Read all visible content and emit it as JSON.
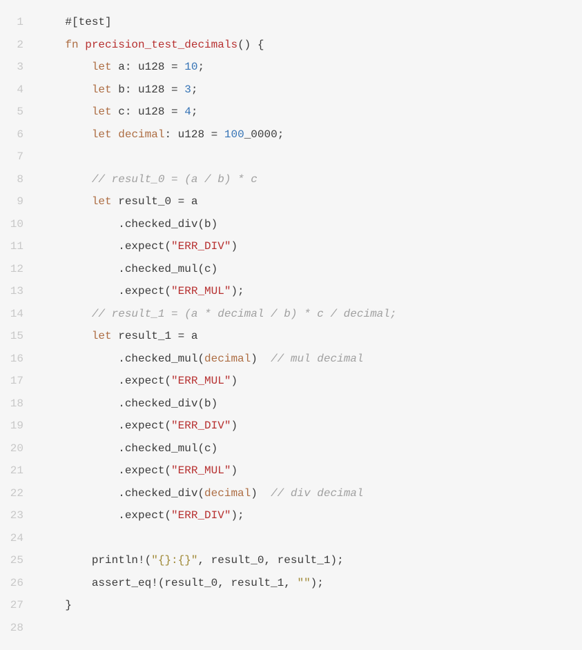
{
  "code": {
    "lines": [
      {
        "n": "1",
        "tokens": [
          {
            "t": "    ",
            "c": "tok-default"
          },
          {
            "t": "#[test]",
            "c": "tok-attr"
          }
        ]
      },
      {
        "n": "2",
        "tokens": [
          {
            "t": "    ",
            "c": "tok-default"
          },
          {
            "t": "fn",
            "c": "tok-keyword"
          },
          {
            "t": " ",
            "c": "tok-default"
          },
          {
            "t": "precision_test_decimals",
            "c": "tok-fn-name"
          },
          {
            "t": "() {",
            "c": "tok-default"
          }
        ]
      },
      {
        "n": "3",
        "tokens": [
          {
            "t": "        ",
            "c": "tok-default"
          },
          {
            "t": "let",
            "c": "tok-keyword"
          },
          {
            "t": " a: u128 = ",
            "c": "tok-default"
          },
          {
            "t": "10",
            "c": "tok-num"
          },
          {
            "t": ";",
            "c": "tok-default"
          }
        ]
      },
      {
        "n": "4",
        "tokens": [
          {
            "t": "        ",
            "c": "tok-default"
          },
          {
            "t": "let",
            "c": "tok-keyword"
          },
          {
            "t": " b: u128 = ",
            "c": "tok-default"
          },
          {
            "t": "3",
            "c": "tok-num"
          },
          {
            "t": ";",
            "c": "tok-default"
          }
        ]
      },
      {
        "n": "5",
        "tokens": [
          {
            "t": "        ",
            "c": "tok-default"
          },
          {
            "t": "let",
            "c": "tok-keyword"
          },
          {
            "t": " c: u128 = ",
            "c": "tok-default"
          },
          {
            "t": "4",
            "c": "tok-num"
          },
          {
            "t": ";",
            "c": "tok-default"
          }
        ]
      },
      {
        "n": "6",
        "tokens": [
          {
            "t": "        ",
            "c": "tok-default"
          },
          {
            "t": "let",
            "c": "tok-keyword"
          },
          {
            "t": " ",
            "c": "tok-default"
          },
          {
            "t": "decimal",
            "c": "tok-ident-deco"
          },
          {
            "t": ": u128 = ",
            "c": "tok-default"
          },
          {
            "t": "100",
            "c": "tok-num"
          },
          {
            "t": "_0000;",
            "c": "tok-default"
          }
        ]
      },
      {
        "n": "7",
        "tokens": [
          {
            "t": "",
            "c": "tok-default"
          }
        ]
      },
      {
        "n": "8",
        "tokens": [
          {
            "t": "        ",
            "c": "tok-default"
          },
          {
            "t": "// result_0 = (a / b) * c",
            "c": "tok-comment"
          }
        ]
      },
      {
        "n": "9",
        "tokens": [
          {
            "t": "        ",
            "c": "tok-default"
          },
          {
            "t": "let",
            "c": "tok-keyword"
          },
          {
            "t": " result_0 = a",
            "c": "tok-default"
          }
        ]
      },
      {
        "n": "10",
        "tokens": [
          {
            "t": "            .checked_div(b)",
            "c": "tok-default"
          }
        ]
      },
      {
        "n": "11",
        "tokens": [
          {
            "t": "            .expect(",
            "c": "tok-default"
          },
          {
            "t": "\"ERR_DIV\"",
            "c": "tok-err-str"
          },
          {
            "t": ")",
            "c": "tok-default"
          }
        ]
      },
      {
        "n": "12",
        "tokens": [
          {
            "t": "            .checked_mul(c)",
            "c": "tok-default"
          }
        ]
      },
      {
        "n": "13",
        "tokens": [
          {
            "t": "            .expect(",
            "c": "tok-default"
          },
          {
            "t": "\"ERR_MUL\"",
            "c": "tok-err-str"
          },
          {
            "t": ");",
            "c": "tok-default"
          }
        ]
      },
      {
        "n": "14",
        "tokens": [
          {
            "t": "        ",
            "c": "tok-default"
          },
          {
            "t": "// result_1 = (a * decimal / b) * c / decimal;",
            "c": "tok-comment"
          }
        ]
      },
      {
        "n": "15",
        "tokens": [
          {
            "t": "        ",
            "c": "tok-default"
          },
          {
            "t": "let",
            "c": "tok-keyword"
          },
          {
            "t": " result_1 = a",
            "c": "tok-default"
          }
        ]
      },
      {
        "n": "16",
        "tokens": [
          {
            "t": "            .checked_mul(",
            "c": "tok-default"
          },
          {
            "t": "decimal",
            "c": "tok-ident-deco"
          },
          {
            "t": ")  ",
            "c": "tok-default"
          },
          {
            "t": "// mul decimal",
            "c": "tok-comment"
          }
        ]
      },
      {
        "n": "17",
        "tokens": [
          {
            "t": "            .expect(",
            "c": "tok-default"
          },
          {
            "t": "\"ERR_MUL\"",
            "c": "tok-err-str"
          },
          {
            "t": ")",
            "c": "tok-default"
          }
        ]
      },
      {
        "n": "18",
        "tokens": [
          {
            "t": "            .checked_div(b)",
            "c": "tok-default"
          }
        ]
      },
      {
        "n": "19",
        "tokens": [
          {
            "t": "            .expect(",
            "c": "tok-default"
          },
          {
            "t": "\"ERR_DIV\"",
            "c": "tok-err-str"
          },
          {
            "t": ")",
            "c": "tok-default"
          }
        ]
      },
      {
        "n": "20",
        "tokens": [
          {
            "t": "            .checked_mul(c)",
            "c": "tok-default"
          }
        ]
      },
      {
        "n": "21",
        "tokens": [
          {
            "t": "            .expect(",
            "c": "tok-default"
          },
          {
            "t": "\"ERR_MUL\"",
            "c": "tok-err-str"
          },
          {
            "t": ")",
            "c": "tok-default"
          }
        ]
      },
      {
        "n": "22",
        "tokens": [
          {
            "t": "            .checked_div(",
            "c": "tok-default"
          },
          {
            "t": "decimal",
            "c": "tok-ident-deco"
          },
          {
            "t": ")  ",
            "c": "tok-default"
          },
          {
            "t": "// div decimal",
            "c": "tok-comment"
          }
        ]
      },
      {
        "n": "23",
        "tokens": [
          {
            "t": "            .expect(",
            "c": "tok-default"
          },
          {
            "t": "\"ERR_DIV\"",
            "c": "tok-err-str"
          },
          {
            "t": ");",
            "c": "tok-default"
          }
        ]
      },
      {
        "n": "24",
        "tokens": [
          {
            "t": "",
            "c": "tok-default"
          }
        ]
      },
      {
        "n": "25",
        "tokens": [
          {
            "t": "        println!(",
            "c": "tok-default"
          },
          {
            "t": "\"{}:{}\"",
            "c": "tok-str"
          },
          {
            "t": ", result_0, result_1);",
            "c": "tok-default"
          }
        ]
      },
      {
        "n": "26",
        "tokens": [
          {
            "t": "        assert_eq!(result_0, result_1, ",
            "c": "tok-default"
          },
          {
            "t": "\"\"",
            "c": "tok-str"
          },
          {
            "t": ");",
            "c": "tok-default"
          }
        ]
      },
      {
        "n": "27",
        "tokens": [
          {
            "t": "    }",
            "c": "tok-default"
          }
        ]
      },
      {
        "n": "28",
        "tokens": [
          {
            "t": "",
            "c": "tok-default"
          }
        ]
      }
    ]
  }
}
